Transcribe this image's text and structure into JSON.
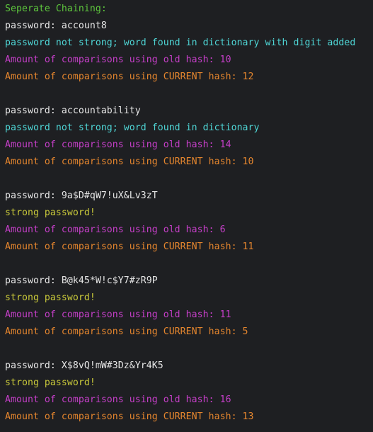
{
  "colors": {
    "background": "#1e1f22",
    "header": "#5ec73d",
    "password": "#e6e6e6",
    "message_weak": "#4fd6d6",
    "message_strong": "#c8c83a",
    "old_hash": "#c53fc8",
    "current_hash": "#e5862e"
  },
  "terminal": {
    "lines": [
      {
        "text": "Seperate Chaining:",
        "color": "header"
      },
      {
        "text": "password: account8",
        "color": "password"
      },
      {
        "text": "password not strong; word found in dictionary with digit added",
        "color": "message_weak"
      },
      {
        "text": "Amount of comparisons using old hash: 10",
        "color": "old_hash"
      },
      {
        "text": "Amount of comparisons using CURRENT hash: 12",
        "color": "current_hash"
      },
      {
        "text": "",
        "color": "password"
      },
      {
        "text": "password: accountability",
        "color": "password"
      },
      {
        "text": "password not strong; word found in dictionary",
        "color": "message_weak"
      },
      {
        "text": "Amount of comparisons using old hash: 14",
        "color": "old_hash"
      },
      {
        "text": "Amount of comparisons using CURRENT hash: 10",
        "color": "current_hash"
      },
      {
        "text": "",
        "color": "password"
      },
      {
        "text": "password: 9a$D#qW7!uX&Lv3zT",
        "color": "password"
      },
      {
        "text": "strong password!",
        "color": "message_strong"
      },
      {
        "text": "Amount of comparisons using old hash: 6",
        "color": "old_hash"
      },
      {
        "text": "Amount of comparisons using CURRENT hash: 11",
        "color": "current_hash"
      },
      {
        "text": "",
        "color": "password"
      },
      {
        "text": "password: B@k45*W!c$Y7#zR9P",
        "color": "password"
      },
      {
        "text": "strong password!",
        "color": "message_strong"
      },
      {
        "text": "Amount of comparisons using old hash: 11",
        "color": "old_hash"
      },
      {
        "text": "Amount of comparisons using CURRENT hash: 5",
        "color": "current_hash"
      },
      {
        "text": "",
        "color": "password"
      },
      {
        "text": "password: X$8vQ!mW#3Dz&Yr4K5",
        "color": "password"
      },
      {
        "text": "strong password!",
        "color": "message_strong"
      },
      {
        "text": "Amount of comparisons using old hash: 16",
        "color": "old_hash"
      },
      {
        "text": "Amount of comparisons using CURRENT hash: 13",
        "color": "current_hash"
      }
    ]
  }
}
